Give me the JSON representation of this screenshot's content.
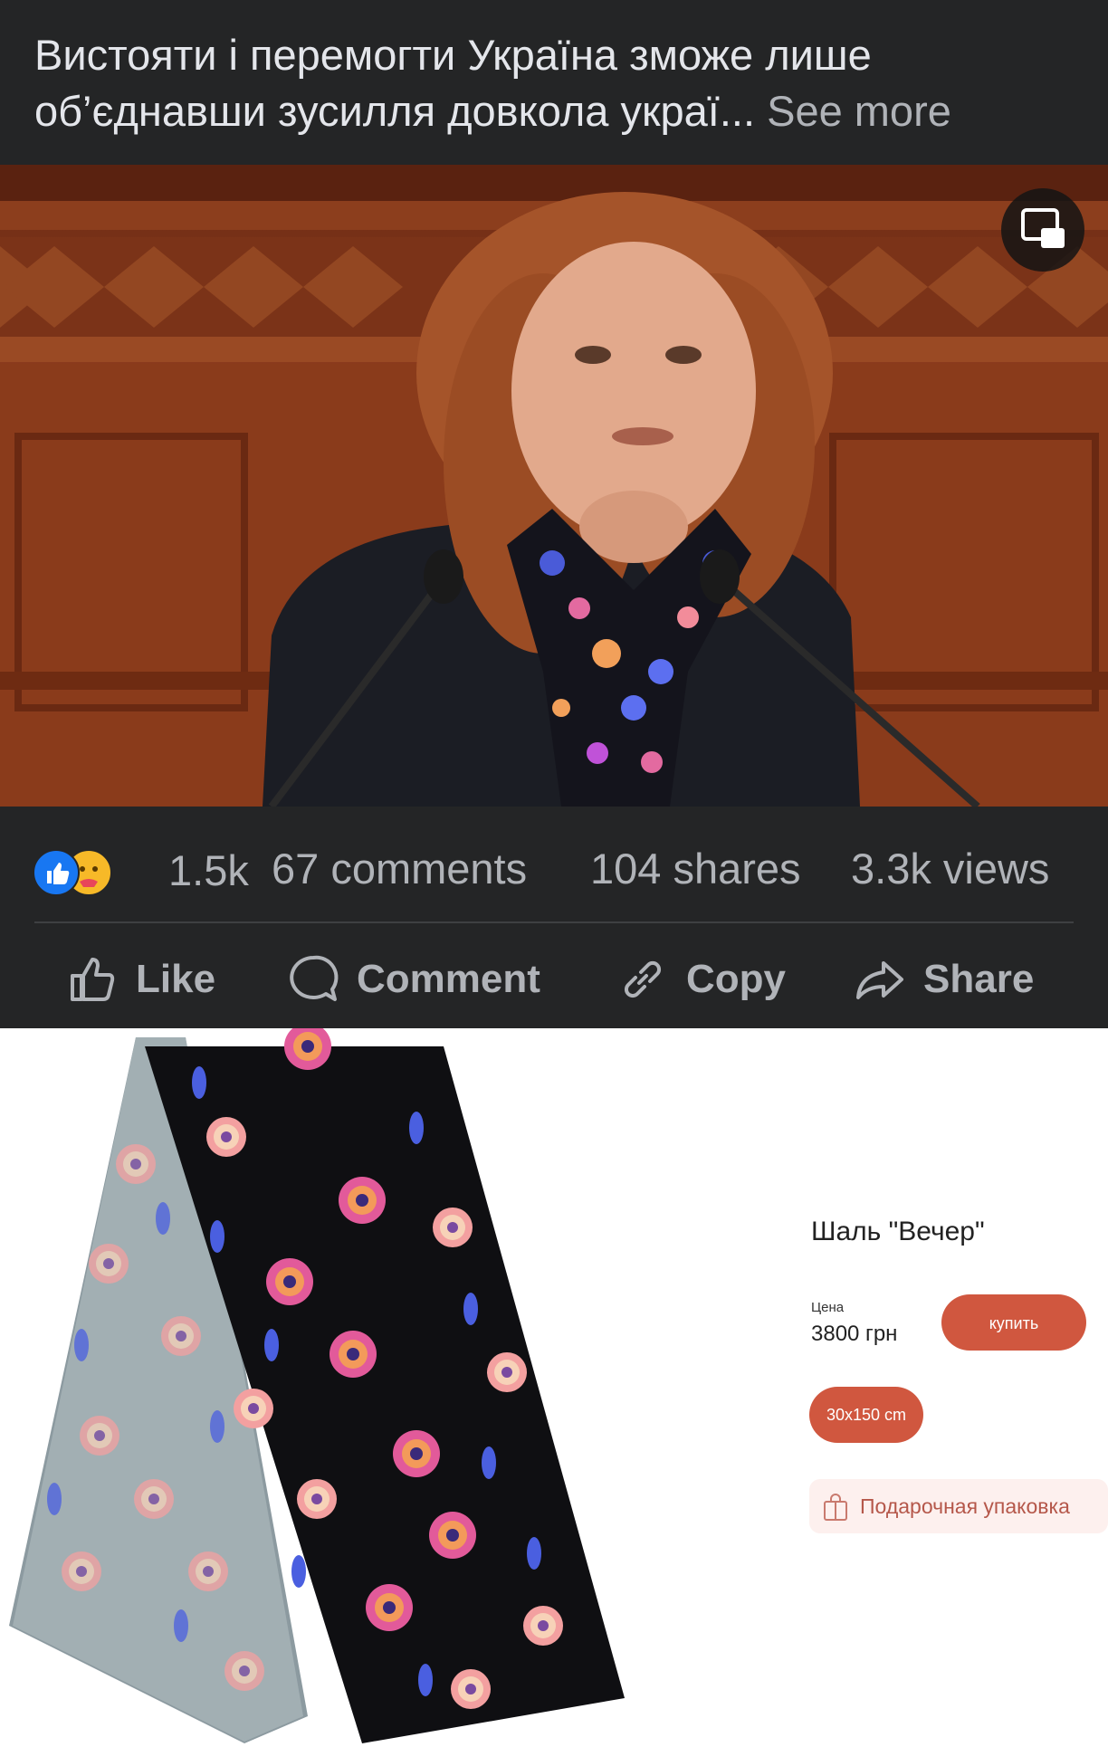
{
  "post": {
    "caption": "Вистояти і перемогти Україна зможе лише об’єднавши зусилля довкола украї...",
    "see_more": "See more",
    "icons": {
      "pip": "picture-in-picture-icon",
      "like_reaction": "thumbs-up-icon",
      "care_reaction": "care-emoji-icon"
    },
    "stats": {
      "reactions": "1.5k",
      "comments": "67 comments",
      "shares": "104 shares",
      "views": "3.3k views"
    },
    "actions": {
      "like": "Like",
      "comment": "Comment",
      "copy": "Copy",
      "share": "Share"
    },
    "colors": {
      "background": "#242526",
      "text": "#e4e6eb",
      "muted": "#b0b3b8",
      "like_blue": "#1877f2"
    }
  },
  "product": {
    "title": "Шаль \"Вечер\"",
    "price_label": "Цена",
    "price": "3800 грн",
    "buy_label": "купить",
    "size": "30x150 cm",
    "gift_wrap_label": "Подарочная упаковка",
    "colors": {
      "accent": "#d0573f",
      "gift_bg": "#fdf0ee"
    }
  }
}
